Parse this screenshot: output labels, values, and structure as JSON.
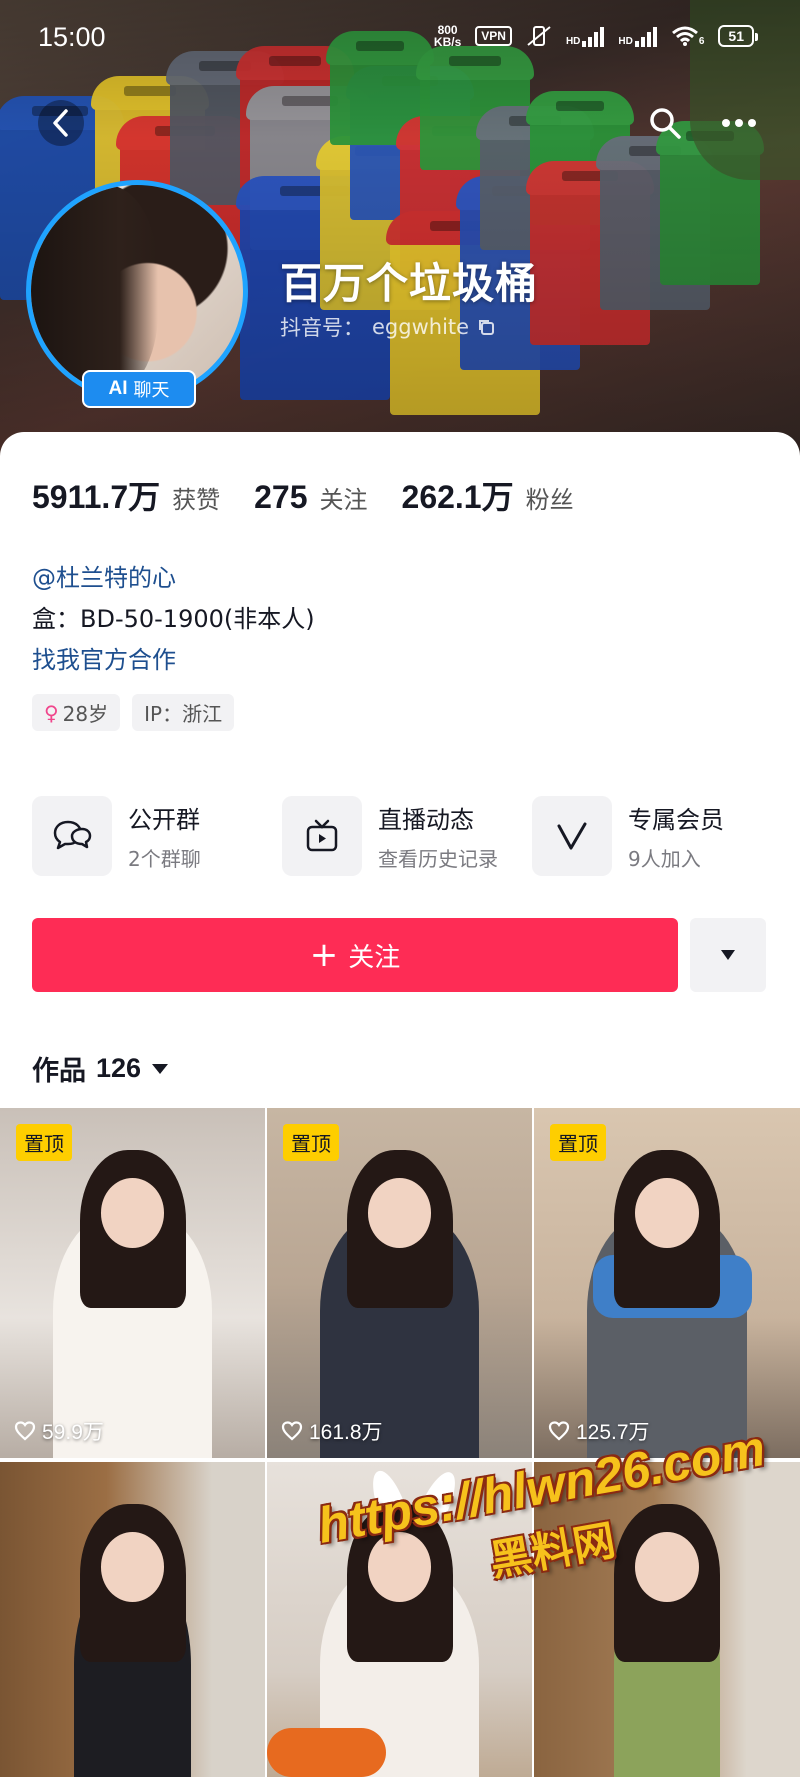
{
  "status_bar": {
    "time": "15:00",
    "net_speed_value": "800",
    "net_speed_unit": "KB/s",
    "vpn": "VPN",
    "signal1_label": "HD",
    "signal2_label": "HD",
    "wifi_label": "6",
    "battery": "51"
  },
  "header": {
    "nickname": "百万个垃圾桶",
    "douyin_id_label": "抖音号：",
    "douyin_id": "eggwhite",
    "ai_badge_bold": "AI",
    "ai_badge_text": "聊天"
  },
  "stats": [
    {
      "value": "5911.7万",
      "label": "获赞"
    },
    {
      "value": "275",
      "label": "关注"
    },
    {
      "value": "262.1万",
      "label": "粉丝"
    }
  ],
  "bio": {
    "mention": "@杜兰特的心",
    "line2": "盒：BD-50-1900(非本人)",
    "link": "找我官方合作"
  },
  "tags": {
    "age": "28岁",
    "ip": "IP：浙江"
  },
  "features": [
    {
      "title": "公开群",
      "sub": "2个群聊",
      "icon": "chat-bubbles-icon"
    },
    {
      "title": "直播动态",
      "sub": "查看历史记录",
      "icon": "tv-icon"
    },
    {
      "title": "专属会员",
      "sub": "9人加入",
      "icon": "v-membership-icon"
    }
  ],
  "follow": {
    "label": "关注"
  },
  "works": {
    "label": "作品",
    "count": "126"
  },
  "videos": [
    {
      "pinned": "置顶",
      "likes": "59.9万"
    },
    {
      "pinned": "置顶",
      "likes": "161.8万"
    },
    {
      "pinned": "置顶",
      "likes": "125.7万"
    },
    {
      "pinned": "",
      "likes": ""
    },
    {
      "pinned": "",
      "likes": ""
    },
    {
      "pinned": "",
      "likes": ""
    }
  ],
  "watermark": {
    "url": "https://hlwn26.com",
    "text": "黑料网"
  },
  "colors": {
    "accent": "#fe2c55",
    "link": "#1e4f8f",
    "avatar_ring": "#1fa3ff",
    "ai_badge": "#1d8cf0",
    "pin_badge": "#fece00"
  }
}
